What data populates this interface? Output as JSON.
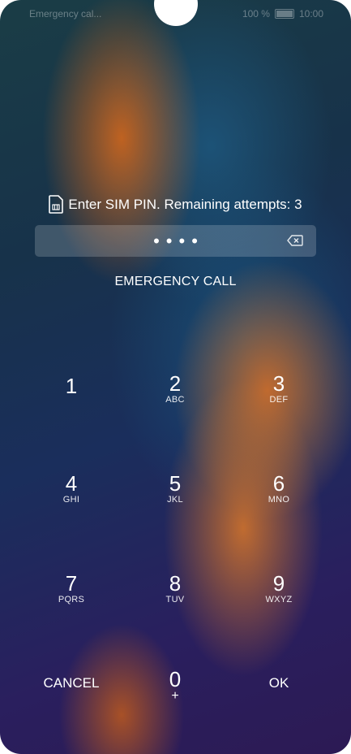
{
  "status_bar": {
    "left_text": "Emergency cal...",
    "battery": "100 %",
    "time": "10:00"
  },
  "sim_prompt": {
    "icon": "sim-card-icon",
    "text": "Enter SIM PIN. Remaining attempts: 3"
  },
  "pin_field": {
    "masked_value": "••••",
    "backspace_icon": "backspace-icon"
  },
  "emergency_call_label": "EMERGENCY CALL",
  "keypad": {
    "k1": {
      "digit": "1",
      "letters": ""
    },
    "k2": {
      "digit": "2",
      "letters": "ABC"
    },
    "k3": {
      "digit": "3",
      "letters": "DEF"
    },
    "k4": {
      "digit": "4",
      "letters": "GHI"
    },
    "k5": {
      "digit": "5",
      "letters": "JKL"
    },
    "k6": {
      "digit": "6",
      "letters": "MNO"
    },
    "k7": {
      "digit": "7",
      "letters": "PQRS"
    },
    "k8": {
      "digit": "8",
      "letters": "TUV"
    },
    "k9": {
      "digit": "9",
      "letters": "WXYZ"
    },
    "k0": {
      "digit": "0",
      "letters": "+"
    },
    "cancel_label": "CANCEL",
    "ok_label": "OK"
  }
}
